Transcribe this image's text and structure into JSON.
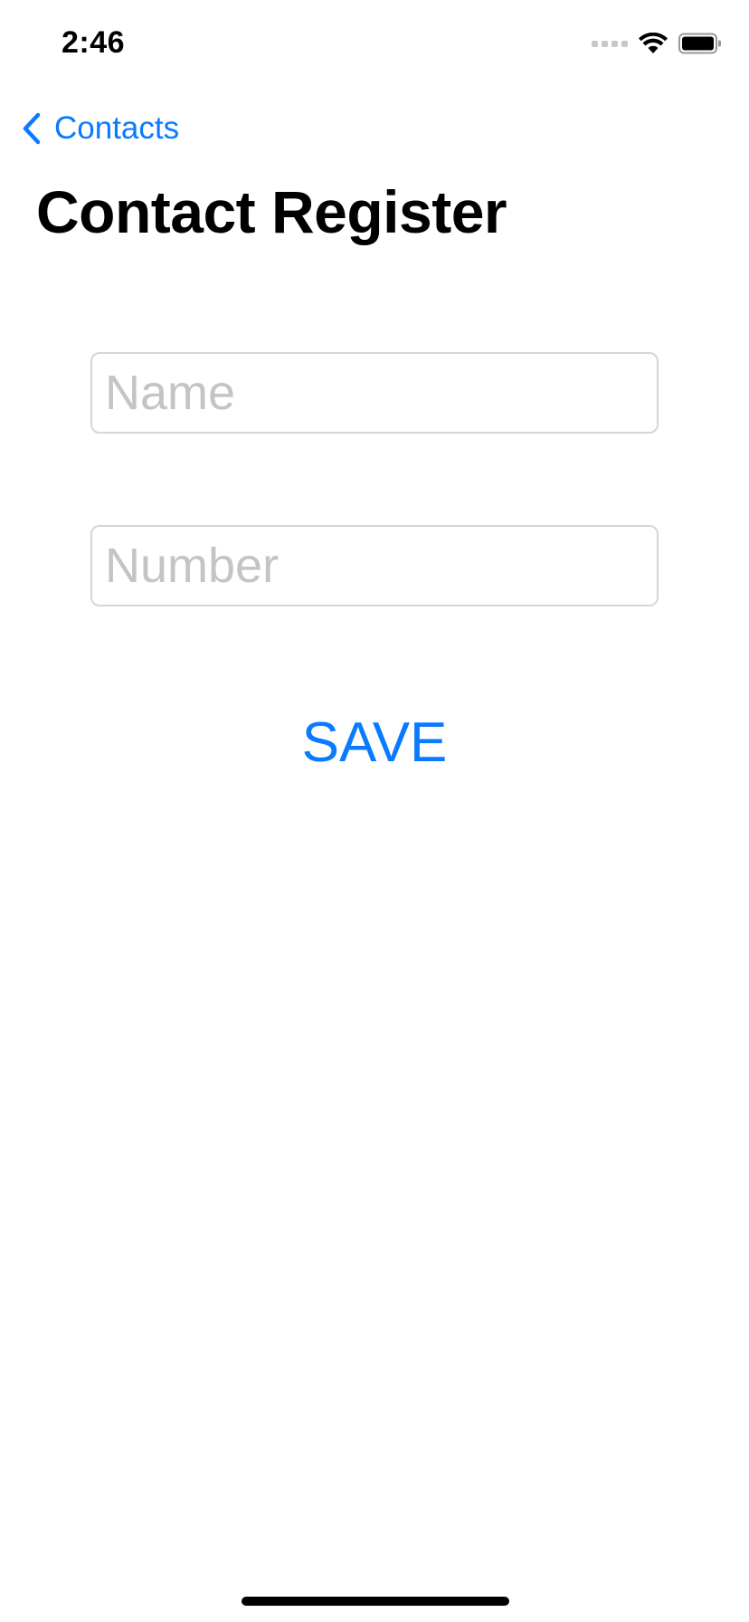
{
  "status_bar": {
    "time": "2:46",
    "icons": [
      "cellular-signal-icon",
      "wifi-icon",
      "battery-icon"
    ]
  },
  "nav": {
    "back_label": "Contacts",
    "back_icon": "chevron-left-icon"
  },
  "page": {
    "title": "Contact Register"
  },
  "form": {
    "name_placeholder": "Name",
    "name_value": "",
    "number_placeholder": "Number",
    "number_value": "",
    "save_label": "SAVE"
  },
  "colors": {
    "accent": "#0a7aff",
    "placeholder": "#c4c4c6",
    "field_border": "#d6d6d6",
    "text": "#000000",
    "background": "#ffffff"
  }
}
